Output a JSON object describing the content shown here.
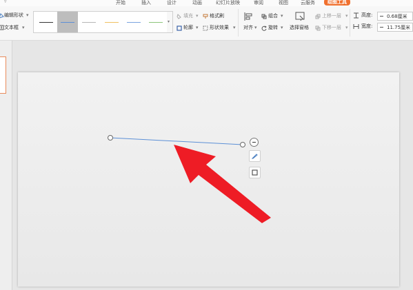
{
  "tabs": [
    {
      "label": "开始"
    },
    {
      "label": "插入"
    },
    {
      "label": "设计"
    },
    {
      "label": "动画"
    },
    {
      "label": "幻灯片放映"
    },
    {
      "label": "审阅"
    },
    {
      "label": "视图"
    },
    {
      "label": "云服务"
    },
    {
      "label": "绘图工具",
      "active": true
    }
  ],
  "ribbon": {
    "edit_shape": "编辑形状",
    "text_box": "文本框",
    "line_styles": [
      {
        "color": "#333333"
      },
      {
        "color": "#5b8fd6",
        "selected": true
      },
      {
        "color": "#b5b5b5"
      },
      {
        "color": "#f0c060"
      },
      {
        "color": "#7aa3e0"
      },
      {
        "color": "#8cc47a"
      }
    ],
    "fill": "填充",
    "format_painter": "格式刷",
    "outline": "轮廓",
    "shape_effects": "形状效果",
    "align": "对齐",
    "group": "组合",
    "rotate": "旋转",
    "selection_pane": "选择窗格",
    "bring_forward": "上移一层",
    "send_backward": "下移一层",
    "height_label": "高度:",
    "height_value": "0.68厘米",
    "width_label": "宽度:",
    "width_value": "11.75厘米"
  },
  "colors": {
    "accent": "#f0702e",
    "line": "#5b8fd6",
    "arrow": "#ee1c25"
  }
}
